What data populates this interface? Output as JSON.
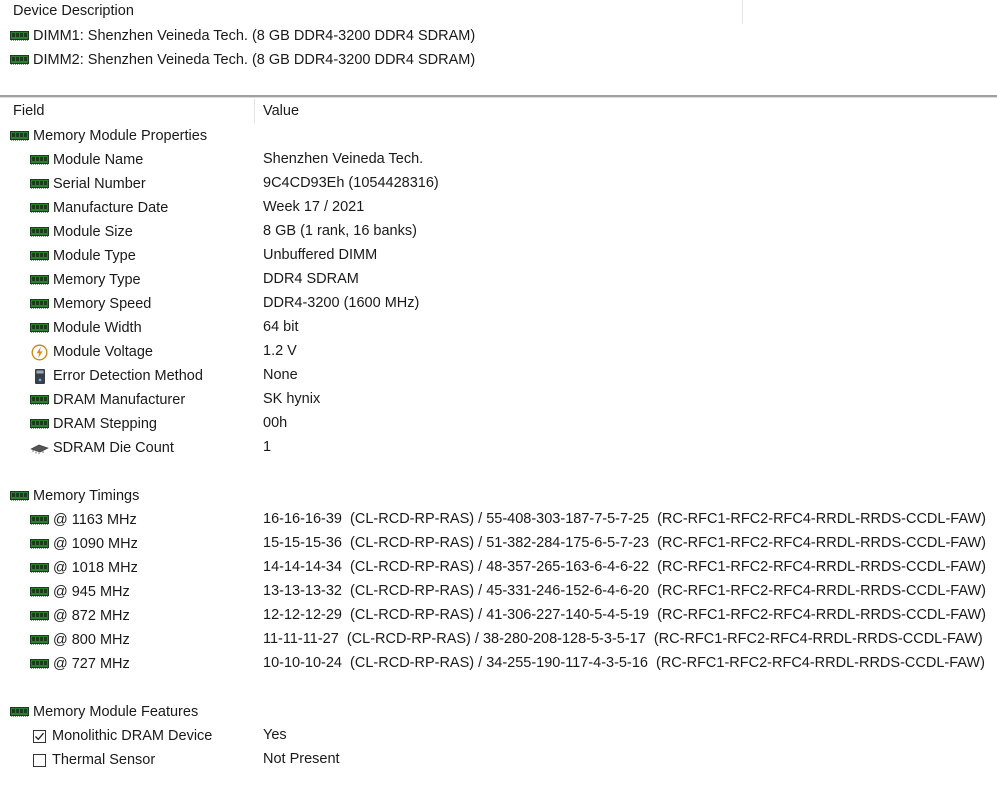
{
  "top_pane": {
    "header": "Device Description",
    "devices": [
      "DIMM1: Shenzhen Veineda Tech. (8 GB DDR4-3200 DDR4 SDRAM)",
      "DIMM2: Shenzhen Veineda Tech. (8 GB DDR4-3200 DDR4 SDRAM)"
    ]
  },
  "columns": {
    "field": "Field",
    "value": "Value"
  },
  "sections": {
    "properties": {
      "title": "Memory Module Properties",
      "rows": [
        {
          "field": "Module Name",
          "value": "Shenzhen Veineda Tech.",
          "icon": "ram-icon"
        },
        {
          "field": "Serial Number",
          "value": "9C4CD93Eh (1054428316)",
          "icon": "ram-icon"
        },
        {
          "field": "Manufacture Date",
          "value": "Week 17 / 2021",
          "icon": "ram-icon"
        },
        {
          "field": "Module Size",
          "value": "8 GB (1 rank, 16 banks)",
          "icon": "ram-icon"
        },
        {
          "field": "Module Type",
          "value": "Unbuffered DIMM",
          "icon": "ram-icon"
        },
        {
          "field": "Memory Type",
          "value": "DDR4 SDRAM",
          "icon": "ram-icon"
        },
        {
          "field": "Memory Speed",
          "value": "DDR4-3200 (1600 MHz)",
          "icon": "ram-icon"
        },
        {
          "field": "Module Width",
          "value": "64 bit",
          "icon": "ram-icon"
        },
        {
          "field": "Module Voltage",
          "value": "1.2 V",
          "icon": "voltage-icon"
        },
        {
          "field": "Error Detection Method",
          "value": "None",
          "icon": "error-detection-icon"
        },
        {
          "field": "DRAM Manufacturer",
          "value": "SK hynix",
          "icon": "ram-icon"
        },
        {
          "field": "DRAM Stepping",
          "value": "00h",
          "icon": "ram-icon"
        },
        {
          "field": "SDRAM Die Count",
          "value": "1",
          "icon": "chip-icon"
        }
      ]
    },
    "timings": {
      "title": "Memory Timings",
      "rows": [
        {
          "field": "@ 1163 MHz",
          "value": "16-16-16-39  (CL-RCD-RP-RAS) / 55-408-303-187-7-5-7-25  (RC-RFC1-RFC2-RFC4-RRDL-RRDS-CCDL-FAW)"
        },
        {
          "field": "@ 1090 MHz",
          "value": "15-15-15-36  (CL-RCD-RP-RAS) / 51-382-284-175-6-5-7-23  (RC-RFC1-RFC2-RFC4-RRDL-RRDS-CCDL-FAW)"
        },
        {
          "field": "@ 1018 MHz",
          "value": "14-14-14-34  (CL-RCD-RP-RAS) / 48-357-265-163-6-4-6-22  (RC-RFC1-RFC2-RFC4-RRDL-RRDS-CCDL-FAW)"
        },
        {
          "field": "@ 945 MHz",
          "value": "13-13-13-32  (CL-RCD-RP-RAS) / 45-331-246-152-6-4-6-20  (RC-RFC1-RFC2-RFC4-RRDL-RRDS-CCDL-FAW)"
        },
        {
          "field": "@ 872 MHz",
          "value": "12-12-12-29  (CL-RCD-RP-RAS) / 41-306-227-140-5-4-5-19  (RC-RFC1-RFC2-RFC4-RRDL-RRDS-CCDL-FAW)"
        },
        {
          "field": "@ 800 MHz",
          "value": "11-11-11-27  (CL-RCD-RP-RAS) / 38-280-208-128-5-3-5-17  (RC-RFC1-RFC2-RFC4-RRDL-RRDS-CCDL-FAW)"
        },
        {
          "field": "@ 727 MHz",
          "value": "10-10-10-24  (CL-RCD-RP-RAS) / 34-255-190-117-4-3-5-16  (RC-RFC1-RFC2-RFC4-RRDL-RRDS-CCDL-FAW)"
        }
      ]
    },
    "features": {
      "title": "Memory Module Features",
      "rows": [
        {
          "field": "Monolithic DRAM Device",
          "value": "Yes",
          "checked": true
        },
        {
          "field": "Thermal Sensor",
          "value": "Not Present",
          "checked": false
        }
      ]
    }
  },
  "colors": {
    "ram_green": "#2e7d32",
    "ram_dark": "#1b3d1d",
    "splitter": "#a0a0a0",
    "voltage_orange": "#e8890c"
  }
}
